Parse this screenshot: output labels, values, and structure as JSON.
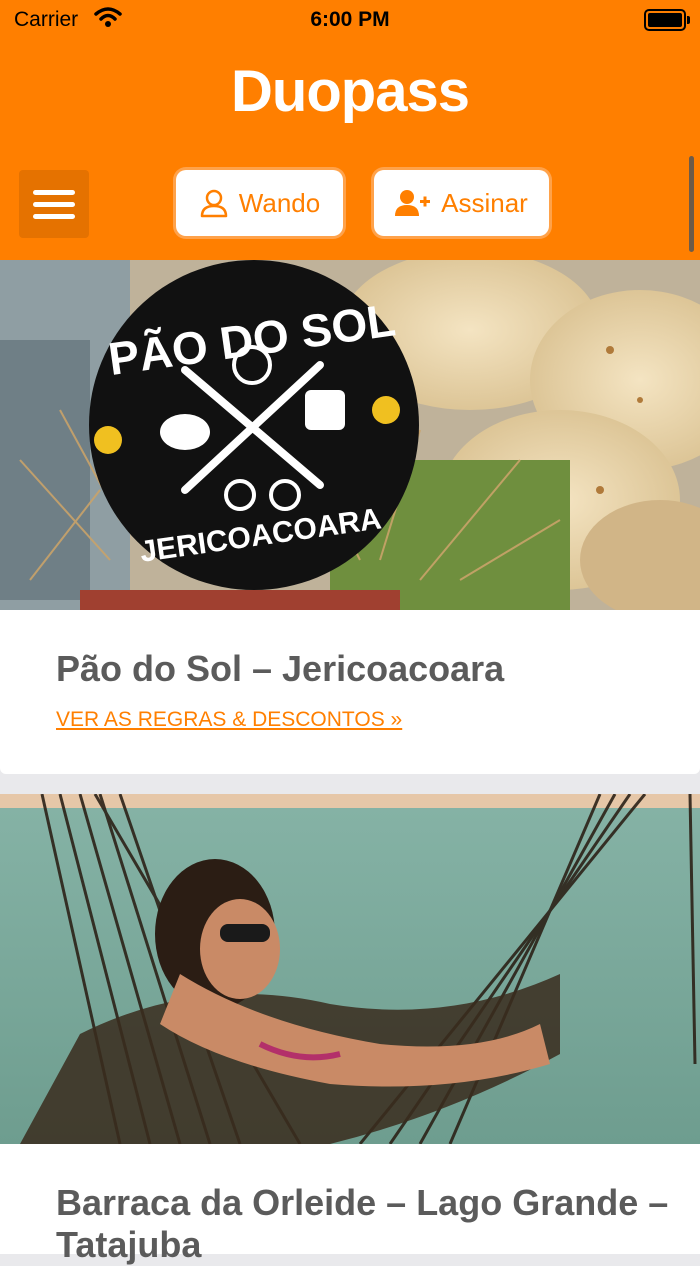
{
  "status_bar": {
    "carrier": "Carrier",
    "time": "6:00 PM"
  },
  "header": {
    "logo": "Duopass",
    "user_button_label": "Wando",
    "subscribe_button_label": "Assinar"
  },
  "colors": {
    "brand": "#ff7f00",
    "title_text": "#5b5b5b"
  },
  "listings": [
    {
      "title": "Pão do Sol – Jericoacoara",
      "link_label": "VER AS REGRAS & DESCONTOS »",
      "image_text": [
        "PÃO DO SOL",
        "JERICOACOARA"
      ]
    },
    {
      "title": "Barraca da Orleide – Lago Grande – Tatajuba"
    }
  ],
  "icons": [
    "wifi-icon",
    "battery-icon",
    "menu-icon",
    "user-icon",
    "user-plus-icon"
  ]
}
